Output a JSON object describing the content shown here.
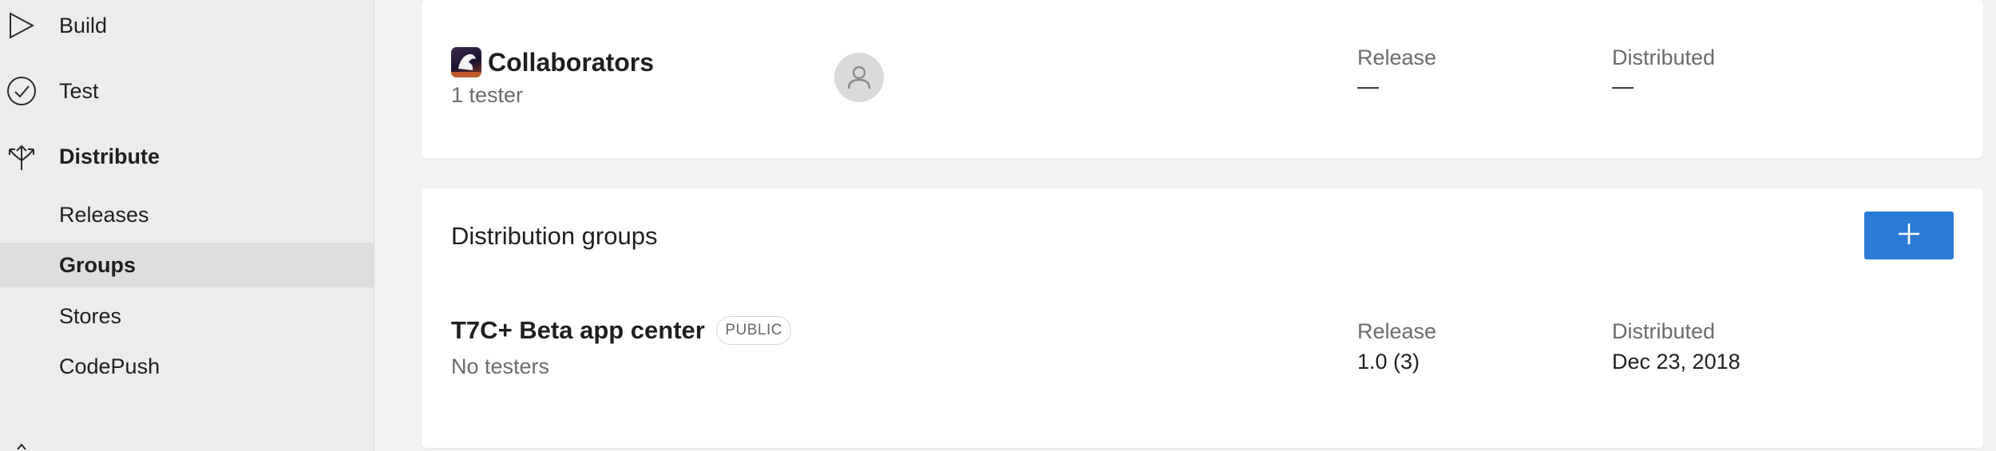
{
  "sidebar": {
    "build": {
      "label": "Build",
      "icon": "play-triangle-icon"
    },
    "test": {
      "label": "Test",
      "icon": "check-circle-icon"
    },
    "distribute": {
      "label": "Distribute",
      "icon": "distribute-arrows-icon"
    },
    "sub_items": [
      {
        "label": "Releases"
      },
      {
        "label": "Groups",
        "active": true
      },
      {
        "label": "Stores"
      },
      {
        "label": "CodePush"
      }
    ]
  },
  "collaborators": {
    "title": "Collaborators",
    "subtitle": "1 tester",
    "release_label": "Release",
    "release_value": "—",
    "distributed_label": "Distributed",
    "distributed_value": "—",
    "app_icon": "app-icon",
    "avatar_icon": "user-avatar-icon"
  },
  "groups": {
    "section_title": "Distribution groups",
    "add_icon": "plus-icon",
    "accent_color": "#2b7bd6",
    "items": [
      {
        "name": "T7C+ Beta app center",
        "badge": "PUBLIC",
        "testers": "No testers",
        "release_label": "Release",
        "release_value": "1.0 (3)",
        "distributed_label": "Distributed",
        "distributed_value": "Dec 23, 2018"
      }
    ]
  }
}
